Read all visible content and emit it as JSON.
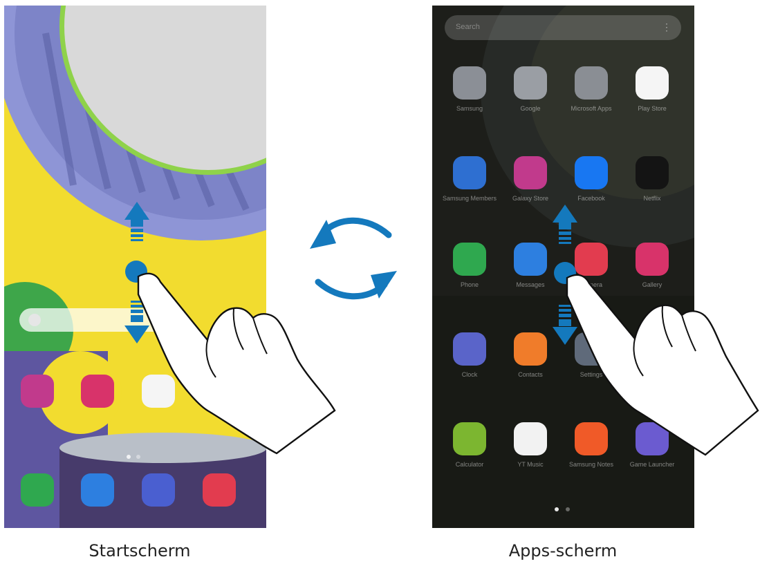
{
  "captions": {
    "home": "Startscherm",
    "apps": "Apps-scherm"
  },
  "apps_screen": {
    "search_placeholder": "Search",
    "apps": [
      {
        "label": "Samsung",
        "icon": "folder-icon",
        "color": "#8b8f96"
      },
      {
        "label": "Google",
        "icon": "folder-icon",
        "color": "#9a9ea4"
      },
      {
        "label": "Microsoft Apps",
        "icon": "folder-icon",
        "color": "#8a8e94"
      },
      {
        "label": "Play Store",
        "icon": "play-store-icon",
        "color": "#f5f5f5"
      },
      {
        "label": "Samsung Members",
        "icon": "samsung-members-icon",
        "color": "#2e6fd1"
      },
      {
        "label": "Galaxy Store",
        "icon": "galaxy-store-icon",
        "color": "#c13a8c"
      },
      {
        "label": "Facebook",
        "icon": "facebook-icon",
        "color": "#1877f2"
      },
      {
        "label": "Netflix",
        "icon": "netflix-icon",
        "color": "#141414"
      },
      {
        "label": "Phone",
        "icon": "phone-icon",
        "color": "#2fa84f"
      },
      {
        "label": "Messages",
        "icon": "messages-icon",
        "color": "#2d7fe0"
      },
      {
        "label": "Camera",
        "icon": "camera-icon",
        "color": "#e23c4f"
      },
      {
        "label": "Gallery",
        "icon": "gallery-icon",
        "color": "#d8336a"
      },
      {
        "label": "Clock",
        "icon": "clock-icon",
        "color": "#5a64c9"
      },
      {
        "label": "Contacts",
        "icon": "contacts-icon",
        "color": "#f07c2a"
      },
      {
        "label": "Settings",
        "icon": "settings-icon",
        "color": "#5f6a7a"
      },
      {
        "label": "",
        "icon": "blank",
        "color": "transparent"
      },
      {
        "label": "Calculator",
        "icon": "calculator-icon",
        "color": "#7cb630"
      },
      {
        "label": "YT Music",
        "icon": "yt-music-icon",
        "color": "#f2f2f2"
      },
      {
        "label": "Samsung Notes",
        "icon": "samsung-notes-icon",
        "color": "#f05a28"
      },
      {
        "label": "Game Launcher",
        "icon": "game-launcher-icon",
        "color": "#6b5bd0"
      }
    ]
  },
  "home_screen": {
    "apps": [
      {
        "label": "Galaxy Store",
        "icon": "galaxy-store-icon",
        "color": "#c13a8c"
      },
      {
        "label": "Gallery",
        "icon": "gallery-icon",
        "color": "#d8336a"
      },
      {
        "label": "Play Store",
        "icon": "play-store-icon",
        "color": "#f5f5f5"
      }
    ],
    "dock": [
      {
        "icon": "phone-icon",
        "color": "#2fa84f"
      },
      {
        "icon": "messages-icon",
        "color": "#2d7fe0"
      },
      {
        "icon": "internet-icon",
        "color": "#4a5fd0"
      },
      {
        "icon": "camera-icon",
        "color": "#e23c4f"
      }
    ]
  },
  "colors": {
    "arrow": "#1479bd",
    "accent": "#1479bd"
  }
}
